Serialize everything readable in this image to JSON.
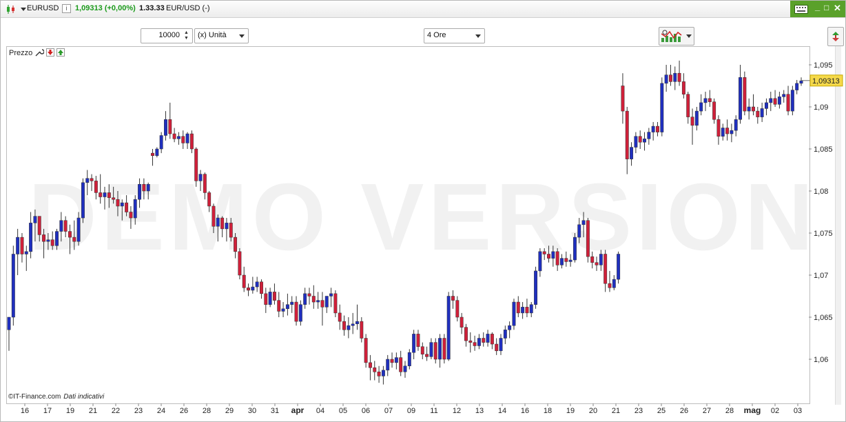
{
  "header": {
    "symbol": "EURUSD",
    "info_glyph": "i",
    "price_change": "1,09313 (+0,00%)",
    "time": "1.33.33",
    "pair_rate": "EUR/USD (-)",
    "window_controls": [
      "_",
      "□",
      "✕"
    ]
  },
  "toolbar": {
    "quantity_value": "10000",
    "unit_select": "(x) Unità",
    "timeframe_select": "4 Ore"
  },
  "legend": {
    "label": "Prezzo"
  },
  "footer": {
    "copyright": "©IT-Finance.com",
    "note": "Dati indicativi"
  },
  "watermark": "DEMO VERSION",
  "colors": {
    "bull": "#1f2fbf",
    "bear": "#d0203a",
    "accent_green": "#5aa12a",
    "last_price_bg": "#f5d94a"
  },
  "chart_data": {
    "type": "candlestick",
    "series_name": "EURUSD",
    "timeframe": "4 Ore",
    "ylim": [
      1.0555,
      1.0963
    ],
    "y_ticks": [
      "1,095",
      "1,09",
      "1,085",
      "1,08",
      "1,075",
      "1,07",
      "1,065",
      "1,06"
    ],
    "y_tick_values": [
      1.095,
      1.09,
      1.085,
      1.08,
      1.075,
      1.07,
      1.065,
      1.06
    ],
    "last_price": "1,09313",
    "last_price_value": 1.09313,
    "x_labels": [
      "16",
      "17",
      "19",
      "21",
      "22",
      "23",
      "24",
      "26",
      "28",
      "29",
      "30",
      "31",
      "apr",
      "04",
      "05",
      "06",
      "07",
      "09",
      "11",
      "12",
      "13",
      "14",
      "16",
      "18",
      "19",
      "20",
      "21",
      "23",
      "25",
      "26",
      "27",
      "28",
      "mag",
      "02",
      "03"
    ],
    "candles": [
      [
        1.0635,
        1.065,
        1.061,
        1.065
      ],
      [
        1.065,
        1.0735,
        1.064,
        1.0725
      ],
      [
        1.0725,
        1.0755,
        1.07,
        1.0745
      ],
      [
        1.0745,
        1.075,
        1.0715,
        1.0725
      ],
      [
        1.0725,
        1.0735,
        1.0705,
        1.0728
      ],
      [
        1.0728,
        1.0775,
        1.072,
        1.0762
      ],
      [
        1.0762,
        1.0778,
        1.074,
        1.077
      ],
      [
        1.077,
        1.077,
        1.074,
        1.0748
      ],
      [
        1.0748,
        1.0755,
        1.072,
        1.074
      ],
      [
        1.074,
        1.075,
        1.073,
        1.0742
      ],
      [
        1.0742,
        1.0752,
        1.073,
        1.0735
      ],
      [
        1.0735,
        1.0755,
        1.073,
        1.0752
      ],
      [
        1.0752,
        1.0775,
        1.074,
        1.0765
      ],
      [
        1.0765,
        1.077,
        1.0745,
        1.0752
      ],
      [
        1.0752,
        1.076,
        1.0725,
        1.0745
      ],
      [
        1.0745,
        1.0765,
        1.073,
        1.074
      ],
      [
        1.074,
        1.0775,
        1.0735,
        1.0768
      ],
      [
        1.0768,
        1.0815,
        1.0762,
        1.081
      ],
      [
        1.081,
        1.0825,
        1.0795,
        1.0815
      ],
      [
        1.0815,
        1.082,
        1.08,
        1.0812
      ],
      [
        1.0812,
        1.0818,
        1.079,
        1.0798
      ],
      [
        1.0798,
        1.082,
        1.0785,
        1.0793
      ],
      [
        1.0793,
        1.0805,
        1.0778,
        1.0798
      ],
      [
        1.0798,
        1.0808,
        1.078,
        1.0792
      ],
      [
        1.0792,
        1.0805,
        1.0785,
        1.079
      ],
      [
        1.079,
        1.08,
        1.077,
        1.0782
      ],
      [
        1.0782,
        1.079,
        1.0765,
        1.0786
      ],
      [
        1.0786,
        1.0795,
        1.077,
        1.0775
      ],
      [
        1.0775,
        1.0782,
        1.0755,
        1.0768
      ],
      [
        1.0768,
        1.0795,
        1.076,
        1.079
      ],
      [
        1.079,
        1.0815,
        1.078,
        1.0808
      ],
      [
        1.0808,
        1.0815,
        1.079,
        1.08
      ],
      [
        1.08,
        1.081,
        1.079,
        1.0808
      ],
      [
        1.0845,
        1.085,
        1.083,
        1.0842
      ],
      [
        1.0842,
        1.0852,
        1.084,
        1.085
      ],
      [
        1.085,
        1.087,
        1.0845,
        1.0866
      ],
      [
        1.0866,
        1.0895,
        1.086,
        1.0885
      ],
      [
        1.0885,
        1.0905,
        1.0862,
        1.0868
      ],
      [
        1.0868,
        1.0875,
        1.0858,
        1.0862
      ],
      [
        1.0862,
        1.087,
        1.0855,
        1.0865
      ],
      [
        1.0865,
        1.0872,
        1.085,
        1.0857
      ],
      [
        1.0857,
        1.087,
        1.085,
        1.0868
      ],
      [
        1.0868,
        1.0872,
        1.0845,
        1.085
      ],
      [
        1.085,
        1.0852,
        1.0805,
        1.0812
      ],
      [
        1.0812,
        1.0825,
        1.08,
        1.082
      ],
      [
        1.082,
        1.0822,
        1.079,
        1.0798
      ],
      [
        1.0798,
        1.08,
        1.0775,
        1.0782
      ],
      [
        1.0782,
        1.0785,
        1.075,
        1.0758
      ],
      [
        1.0758,
        1.0772,
        1.074,
        1.0768
      ],
      [
        1.0768,
        1.077,
        1.0745,
        1.0755
      ],
      [
        1.0755,
        1.0768,
        1.074,
        1.0762
      ],
      [
        1.0762,
        1.0768,
        1.074,
        1.0745
      ],
      [
        1.0745,
        1.075,
        1.072,
        1.0728
      ],
      [
        1.0728,
        1.0732,
        1.0695,
        1.07
      ],
      [
        1.07,
        1.071,
        1.068,
        1.0685
      ],
      [
        1.0685,
        1.069,
        1.0675,
        1.0682
      ],
      [
        1.0682,
        1.0698,
        1.0678,
        1.0686
      ],
      [
        1.0686,
        1.0698,
        1.068,
        1.0692
      ],
      [
        1.0692,
        1.0695,
        1.0672,
        1.0678
      ],
      [
        1.0678,
        1.0685,
        1.0655,
        1.0665
      ],
      [
        1.0665,
        1.0685,
        1.0662,
        1.068
      ],
      [
        1.068,
        1.069,
        1.0665,
        1.067
      ],
      [
        1.067,
        1.068,
        1.065,
        1.0657
      ],
      [
        1.0657,
        1.0668,
        1.065,
        1.066
      ],
      [
        1.066,
        1.0678,
        1.0652,
        1.0665
      ],
      [
        1.0665,
        1.0675,
        1.0655,
        1.0668
      ],
      [
        1.0668,
        1.0675,
        1.064,
        1.0645
      ],
      [
        1.0645,
        1.067,
        1.064,
        1.0665
      ],
      [
        1.0665,
        1.0685,
        1.066,
        1.0678
      ],
      [
        1.0678,
        1.0685,
        1.0665,
        1.0675
      ],
      [
        1.0675,
        1.0688,
        1.066,
        1.0668
      ],
      [
        1.0668,
        1.068,
        1.066,
        1.067
      ],
      [
        1.067,
        1.068,
        1.064,
        1.0662
      ],
      [
        1.0662,
        1.0675,
        1.0655,
        1.0675
      ],
      [
        1.0675,
        1.0685,
        1.0662,
        1.0678
      ],
      [
        1.0678,
        1.0682,
        1.065,
        1.0655
      ],
      [
        1.0655,
        1.0665,
        1.0635,
        1.0645
      ],
      [
        1.0645,
        1.0652,
        1.0628,
        1.0635
      ],
      [
        1.0635,
        1.065,
        1.0625,
        1.064
      ],
      [
        1.064,
        1.0655,
        1.063,
        1.0642
      ],
      [
        1.0642,
        1.0665,
        1.0635,
        1.0645
      ],
      [
        1.0645,
        1.065,
        1.062,
        1.0625
      ],
      [
        1.0625,
        1.063,
        1.059,
        1.0596
      ],
      [
        1.0596,
        1.0605,
        1.0575,
        1.059
      ],
      [
        1.059,
        1.0598,
        1.0575,
        1.0585
      ],
      [
        1.0585,
        1.0592,
        1.0572,
        1.058
      ],
      [
        1.058,
        1.0592,
        1.057,
        1.0587
      ],
      [
        1.0587,
        1.0605,
        1.058,
        1.06
      ],
      [
        1.06,
        1.0608,
        1.059,
        1.0596
      ],
      [
        1.0596,
        1.0608,
        1.0588,
        1.0602
      ],
      [
        1.0602,
        1.061,
        1.058,
        1.0585
      ],
      [
        1.0585,
        1.0598,
        1.0578,
        1.0592
      ],
      [
        1.0592,
        1.0612,
        1.0588,
        1.0608
      ],
      [
        1.0608,
        1.0635,
        1.06,
        1.063
      ],
      [
        1.063,
        1.0635,
        1.061,
        1.0615
      ],
      [
        1.0615,
        1.062,
        1.06,
        1.0606
      ],
      [
        1.0606,
        1.0615,
        1.0598,
        1.0603
      ],
      [
        1.0603,
        1.0625,
        1.06,
        1.062
      ],
      [
        1.062,
        1.0625,
        1.0595,
        1.06
      ],
      [
        1.06,
        1.063,
        1.059,
        1.0625
      ],
      [
        1.0625,
        1.063,
        1.0595,
        1.06
      ],
      [
        1.06,
        1.068,
        1.0598,
        1.0675
      ],
      [
        1.0675,
        1.0682,
        1.066,
        1.067
      ],
      [
        1.067,
        1.0675,
        1.0645,
        1.065
      ],
      [
        1.065,
        1.0655,
        1.063,
        1.0638
      ],
      [
        1.0638,
        1.0642,
        1.0615,
        1.0622
      ],
      [
        1.0622,
        1.0632,
        1.0608,
        1.062
      ],
      [
        1.062,
        1.0628,
        1.061,
        1.0616
      ],
      [
        1.0616,
        1.063,
        1.0612,
        1.0625
      ],
      [
        1.0625,
        1.0632,
        1.0615,
        1.062
      ],
      [
        1.062,
        1.0635,
        1.0615,
        1.063
      ],
      [
        1.063,
        1.0632,
        1.0612,
        1.0618
      ],
      [
        1.0618,
        1.0625,
        1.0605,
        1.061
      ],
      [
        1.061,
        1.063,
        1.0605,
        1.0625
      ],
      [
        1.0625,
        1.064,
        1.0618,
        1.0635
      ],
      [
        1.0635,
        1.0645,
        1.0625,
        1.064
      ],
      [
        1.064,
        1.0672,
        1.0635,
        1.0668
      ],
      [
        1.0668,
        1.0675,
        1.065,
        1.0655
      ],
      [
        1.0655,
        1.0668,
        1.0648,
        1.0662
      ],
      [
        1.0662,
        1.0672,
        1.065,
        1.0655
      ],
      [
        1.0655,
        1.0668,
        1.065,
        1.0665
      ],
      [
        1.0665,
        1.071,
        1.066,
        1.0705
      ],
      [
        1.0705,
        1.0732,
        1.0698,
        1.0728
      ],
      [
        1.0728,
        1.0732,
        1.0718,
        1.0725
      ],
      [
        1.0725,
        1.0735,
        1.0715,
        1.072
      ],
      [
        1.072,
        1.0735,
        1.071,
        1.0728
      ],
      [
        1.0728,
        1.0732,
        1.0705,
        1.0712
      ],
      [
        1.0712,
        1.0725,
        1.0708,
        1.072
      ],
      [
        1.072,
        1.0728,
        1.071,
        1.0716
      ],
      [
        1.0716,
        1.0725,
        1.071,
        1.0718
      ],
      [
        1.0718,
        1.075,
        1.0715,
        1.0745
      ],
      [
        1.0745,
        1.0768,
        1.0738,
        1.076
      ],
      [
        1.076,
        1.0775,
        1.0745,
        1.0765
      ],
      [
        1.0765,
        1.0768,
        1.0715,
        1.0722
      ],
      [
        1.0722,
        1.0728,
        1.0708,
        1.0715
      ],
      [
        1.0715,
        1.0722,
        1.0705,
        1.0712
      ],
      [
        1.0712,
        1.073,
        1.0705,
        1.0725
      ],
      [
        1.0725,
        1.073,
        1.068,
        1.069
      ],
      [
        1.069,
        1.0705,
        1.068,
        1.0685
      ],
      [
        1.0685,
        1.07,
        1.0682,
        1.0695
      ],
      [
        1.0695,
        1.0728,
        1.069,
        1.0725
      ],
      [
        1.0925,
        1.094,
        1.088,
        1.0895
      ],
      [
        1.0895,
        1.09,
        1.082,
        1.0838
      ],
      [
        1.0838,
        1.0858,
        1.083,
        1.0852
      ],
      [
        1.0852,
        1.087,
        1.0845,
        1.0865
      ],
      [
        1.0865,
        1.0872,
        1.085,
        1.0858
      ],
      [
        1.0858,
        1.087,
        1.0848,
        1.0862
      ],
      [
        1.0862,
        1.0875,
        1.0855,
        1.087
      ],
      [
        1.087,
        1.0882,
        1.086,
        1.0877
      ],
      [
        1.0877,
        1.0882,
        1.0865,
        1.087
      ],
      [
        1.087,
        1.0935,
        1.0865,
        1.0928
      ],
      [
        1.0928,
        1.095,
        1.0918,
        1.0938
      ],
      [
        1.0938,
        1.095,
        1.0925,
        1.093
      ],
      [
        1.093,
        1.0948,
        1.092,
        1.094
      ],
      [
        1.094,
        1.0955,
        1.0925,
        1.093
      ],
      [
        1.093,
        1.094,
        1.091,
        1.0915
      ],
      [
        1.0915,
        1.0918,
        1.088,
        1.0888
      ],
      [
        1.0888,
        1.0898,
        1.0855,
        1.0878
      ],
      [
        1.0878,
        1.09,
        1.0872,
        1.0895
      ],
      [
        1.0895,
        1.0915,
        1.089,
        1.0905
      ],
      [
        1.0905,
        1.0918,
        1.0895,
        1.091
      ],
      [
        1.091,
        1.092,
        1.09,
        1.0906
      ],
      [
        1.0906,
        1.091,
        1.088,
        1.0885
      ],
      [
        1.0885,
        1.089,
        1.0855,
        1.0865
      ],
      [
        1.0865,
        1.088,
        1.086,
        1.0875
      ],
      [
        1.0875,
        1.0885,
        1.086,
        1.0868
      ],
      [
        1.0868,
        1.088,
        1.0858,
        1.0872
      ],
      [
        1.0872,
        1.089,
        1.0865,
        1.0885
      ],
      [
        1.0885,
        1.095,
        1.088,
        1.0935
      ],
      [
        1.0935,
        1.0942,
        1.089,
        1.0895
      ],
      [
        1.0895,
        1.091,
        1.0885,
        1.09
      ],
      [
        1.09,
        1.0915,
        1.089,
        1.0895
      ],
      [
        1.0895,
        1.09,
        1.088,
        1.0888
      ],
      [
        1.0888,
        1.0905,
        1.0882,
        1.0898
      ],
      [
        1.0898,
        1.091,
        1.089,
        1.0905
      ],
      [
        1.0905,
        1.0918,
        1.0895,
        1.091
      ],
      [
        1.091,
        1.092,
        1.09,
        1.0903
      ],
      [
        1.0903,
        1.0918,
        1.0898,
        1.0912
      ],
      [
        1.0912,
        1.092,
        1.0905,
        1.0915
      ],
      [
        1.0915,
        1.0925,
        1.089,
        1.0895
      ],
      [
        1.0895,
        1.0925,
        1.089,
        1.092
      ],
      [
        1.092,
        1.0932,
        1.0915,
        1.0928
      ],
      [
        1.0928,
        1.0935,
        1.0925,
        1.0931
      ]
    ]
  }
}
